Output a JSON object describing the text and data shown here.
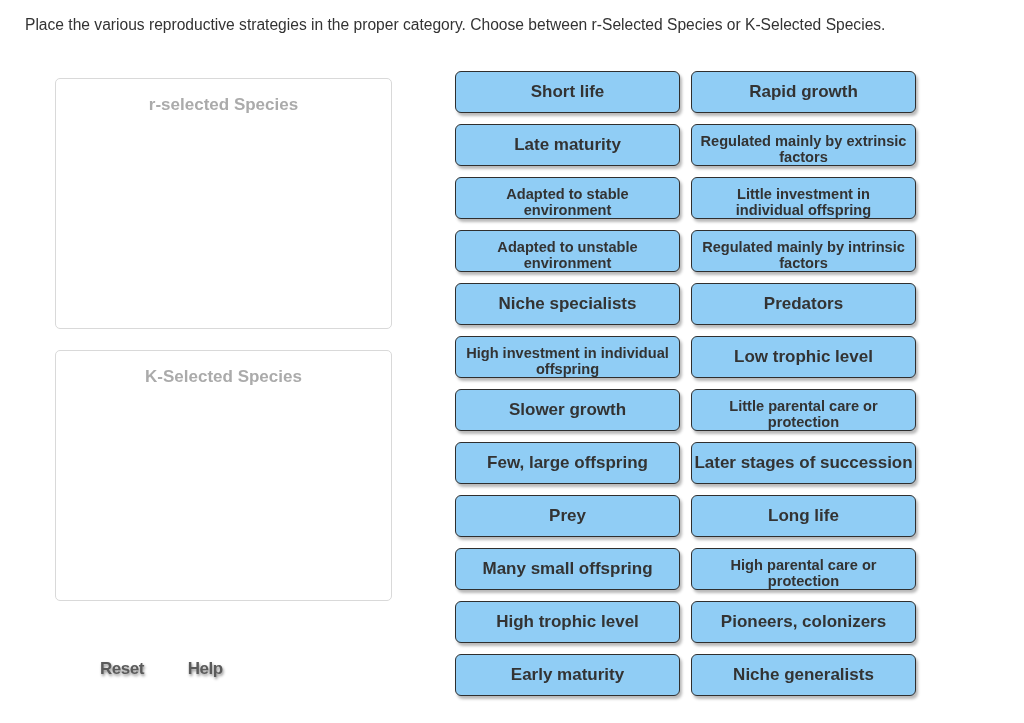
{
  "instruction": "Place the various reproductive strategies in the proper category. Choose between r-Selected Species or K-Selected Species.",
  "drop_zones": [
    {
      "title": "r-selected Species"
    },
    {
      "title": "K-Selected Species"
    }
  ],
  "cards": [
    {
      "lines": [
        "Short life"
      ]
    },
    {
      "lines": [
        "Rapid growth"
      ]
    },
    {
      "lines": [
        "Late maturity"
      ]
    },
    {
      "lines": [
        "Regulated mainly by extrinsic",
        "factors"
      ]
    },
    {
      "lines": [
        "Adapted to stable",
        "environment"
      ]
    },
    {
      "lines": [
        "Little investment in",
        "individual offspring"
      ]
    },
    {
      "lines": [
        "Adapted to unstable",
        "environment"
      ]
    },
    {
      "lines": [
        "Regulated mainly by intrinsic",
        "factors"
      ]
    },
    {
      "lines": [
        "Niche specialists"
      ]
    },
    {
      "lines": [
        "Predators"
      ]
    },
    {
      "lines": [
        "High investment in individual",
        "offspring"
      ]
    },
    {
      "lines": [
        "Low trophic level"
      ]
    },
    {
      "lines": [
        "Slower growth"
      ]
    },
    {
      "lines": [
        "Little parental care or",
        "protection"
      ]
    },
    {
      "lines": [
        "Few, large offspring"
      ]
    },
    {
      "lines": [
        "Later stages of succession"
      ]
    },
    {
      "lines": [
        "Prey"
      ]
    },
    {
      "lines": [
        "Long life"
      ]
    },
    {
      "lines": [
        "Many small offspring"
      ]
    },
    {
      "lines": [
        "High parental care or",
        "protection"
      ]
    },
    {
      "lines": [
        "High trophic level"
      ]
    },
    {
      "lines": [
        "Pioneers, colonizers"
      ]
    },
    {
      "lines": [
        "Early maturity"
      ]
    },
    {
      "lines": [
        "Niche generalists"
      ]
    }
  ],
  "actions": [
    "Reset",
    "Help"
  ]
}
